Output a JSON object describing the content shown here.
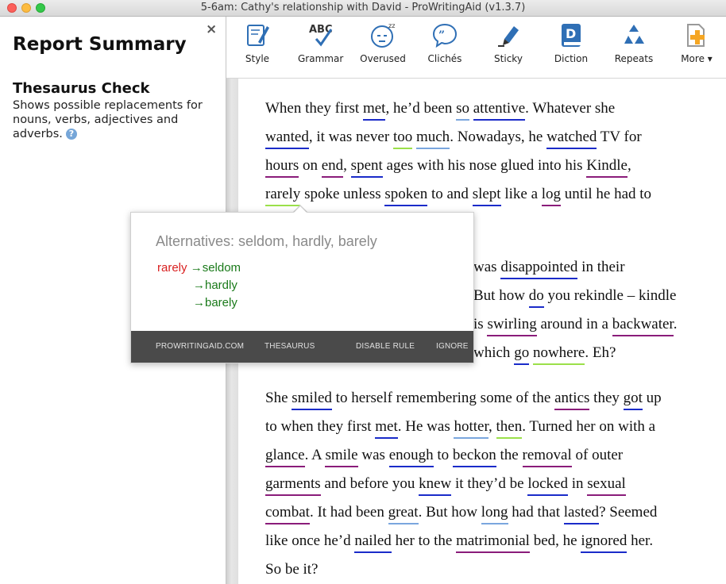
{
  "window": {
    "title": "5-6am: Cathy's relationship with David - ProWritingAid (v1.3.7)"
  },
  "left_panel": {
    "title": "Report Summary",
    "close_symbol": "×",
    "section_title": "Thesaurus Check",
    "section_description": "Shows possible replacements for nouns, verbs, adjectives and adverbs.",
    "help_symbol": "?"
  },
  "toolbar": {
    "buttons": [
      {
        "label": "Style",
        "icon": "style-icon"
      },
      {
        "label": "Grammar",
        "icon": "grammar-icon"
      },
      {
        "label": "Overused",
        "icon": "overused-icon"
      },
      {
        "label": "Clichés",
        "icon": "cliches-icon"
      },
      {
        "label": "Sticky",
        "icon": "sticky-icon"
      },
      {
        "label": "Diction",
        "icon": "diction-icon"
      },
      {
        "label": "Repeats",
        "icon": "repeats-icon"
      },
      {
        "label": "More ▾",
        "icon": "more-icon"
      }
    ]
  },
  "colors": {
    "accent_blue": "#2f6fb5",
    "underline_blue": "#1a2bc9",
    "underline_light_blue": "#7aa6de",
    "underline_purple": "#8a1c7a",
    "underline_green": "#9be04a",
    "original_red": "#d92020",
    "alternative_green": "#1a7a1a"
  },
  "document": {
    "paragraph1": {
      "line1": [
        "When they first ",
        "met",
        ", he’d been ",
        "so",
        " ",
        "attentive",
        ". Whatever she"
      ],
      "line2": [
        "wanted",
        ", it was never ",
        "too",
        " ",
        "much",
        ". Nowadays, he ",
        "watched",
        " TV for"
      ],
      "line3": [
        "hours",
        " on ",
        "end",
        ", ",
        "spent",
        " ages with his nose glued into his ",
        "Kindle",
        ","
      ],
      "line4": [
        "rarely",
        " spoke unless ",
        "spoken",
        " to and ",
        "slept",
        " like a ",
        "log",
        " until he had to"
      ]
    },
    "paragraph2": {
      "line1": [
        "was ",
        "disappointed",
        " in their"
      ],
      "line2": [
        "But how ",
        "do",
        " you rekindle – kindle"
      ],
      "line3": [
        "is ",
        "swirling",
        " around in a ",
        "backwater",
        "."
      ],
      "line4": [
        "which ",
        "go",
        " ",
        "nowhere",
        ". Eh?"
      ]
    },
    "paragraph3": {
      "line1": [
        "She ",
        "smiled",
        " to herself remembering some of the ",
        "antics",
        " they ",
        "got",
        " up"
      ],
      "line2": [
        "to when they first ",
        "met",
        ". He was ",
        "hotter",
        ", ",
        "then",
        ". Turned her on with a"
      ],
      "line3": [
        "glance",
        ". A ",
        "smile",
        " was ",
        "enough",
        " to ",
        "beckon",
        " the ",
        "removal",
        " of outer"
      ],
      "line4": [
        "garments",
        " and before you ",
        "knew",
        " it they’d be ",
        "locked",
        " in ",
        "sexual"
      ],
      "line5": [
        "combat",
        ". It had been ",
        "great",
        ". But how ",
        "long",
        " had that ",
        "lasted",
        "? Seemed"
      ],
      "line6": [
        "like once he’d ",
        "nailed",
        " her to the ",
        "matrimonial",
        " bed, he ",
        "ignored",
        " her."
      ],
      "line7": [
        "So be it?"
      ]
    }
  },
  "popup": {
    "title": "Alternatives: seldom, hardly, barely",
    "original": "rarely",
    "arrow": "→",
    "alternatives": [
      "seldom",
      "hardly",
      "barely"
    ],
    "footer": {
      "brand": "PROWRITINGAID.COM",
      "rule": "THESAURUS",
      "disable": "DISABLE RULE",
      "ignore": "IGNORE"
    }
  }
}
